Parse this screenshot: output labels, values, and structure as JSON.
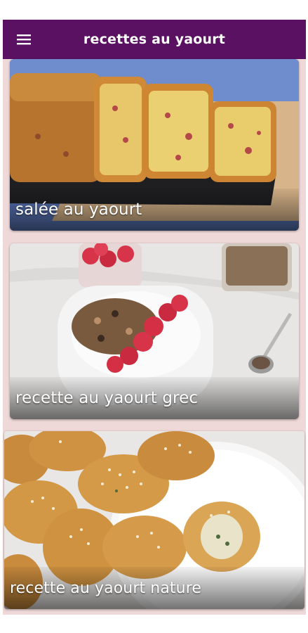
{
  "app": {
    "title": "recettes au yaourt",
    "menu_icon": "hamburger-menu-icon",
    "colors": {
      "appbar": "#5a1161",
      "background": "#efd8d8",
      "caption_text": "#ffffff"
    }
  },
  "recipes": [
    {
      "label": "salée au yaourt",
      "image": "savory-yogurt-cake-photo"
    },
    {
      "label": "recette au yaourt grec",
      "image": "greek-yogurt-bowl-photo"
    },
    {
      "label": "recette au yaourt nature",
      "image": "sesame-pastries-photo"
    }
  ]
}
